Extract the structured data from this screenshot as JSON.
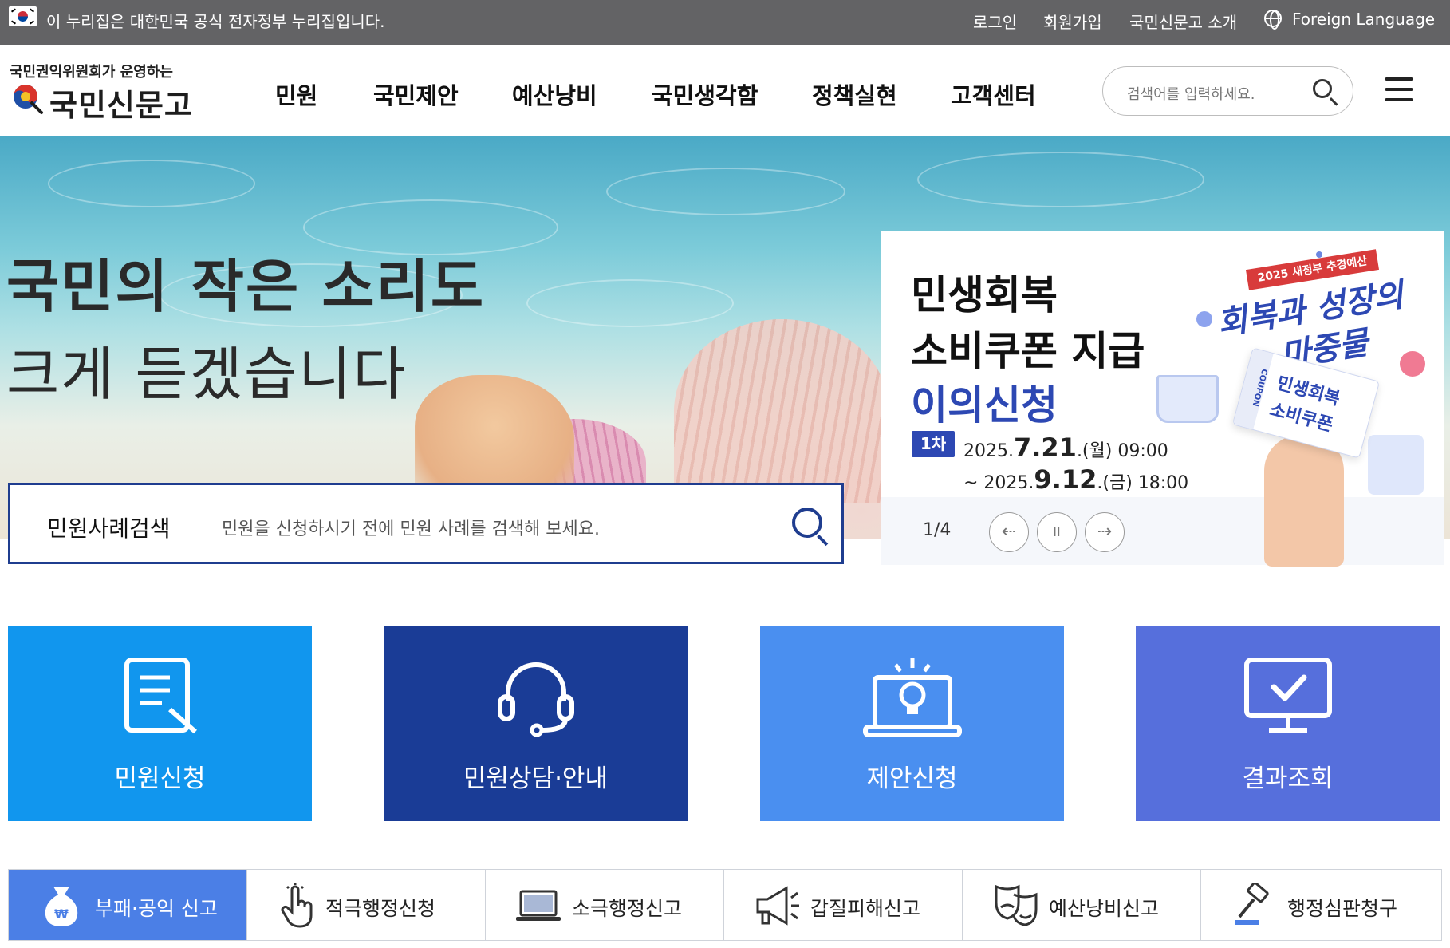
{
  "gov_bar": {
    "notice": "이 누리집은 대한민국 공식 전자정부 누리집입니다.",
    "links": [
      "로그인",
      "회원가입",
      "국민신문고 소개"
    ],
    "foreign_language": "Foreign Language"
  },
  "header": {
    "logo_subtitle": "국민권익위원회가 운영하는",
    "logo_title": "국민신문고",
    "nav": [
      "민원",
      "국민제안",
      "예산낭비",
      "국민생각함",
      "정책실현",
      "고객센터"
    ],
    "search_placeholder": "검색어를 입력하세요."
  },
  "hero": {
    "title_line1": "국민의 작은 소리도",
    "title_line2": "크게 듣겠습니다",
    "case_search": {
      "label": "민원사례검색",
      "placeholder": "민원을 신청하시기 전에 민원 사례를 검색해 보세요."
    }
  },
  "banner": {
    "title_line1": "민생회복",
    "title_line2": "소비쿠폰 지급",
    "title_line3": "이의신청",
    "round": "1차",
    "date_start_prefix": "2025.",
    "date_start_big": "7.21",
    "date_start_suffix": ".(월) 09:00",
    "date_end_prefix": "~ 2025.",
    "date_end_big": "9.12",
    "date_end_suffix": ".(금) 18:00",
    "promo_tag": "2025 새정부 추경예산",
    "promo_line1": "회복과 성장의",
    "promo_line2": "마중물",
    "coupon_line1": "민생회복",
    "coupon_line2": "소비쿠폰",
    "coupon_strip": "COUPON",
    "counter": "1/4",
    "controls": {
      "prev": "⇠",
      "pause": "II",
      "next": "⇢"
    }
  },
  "tiles": [
    {
      "label": "민원신청",
      "color": "#1196ee",
      "icon": "document-pen-icon"
    },
    {
      "label": "민원상담·안내",
      "color": "#1a3c96",
      "icon": "headset-icon"
    },
    {
      "label": "제안신청",
      "color": "#4a8ff0",
      "icon": "laptop-bulb-icon"
    },
    {
      "label": "결과조회",
      "color": "#566fdc",
      "icon": "monitor-check-icon"
    }
  ],
  "report_tabs": [
    {
      "label": "부패·공익 신고",
      "icon": "money-bag-icon",
      "active": true
    },
    {
      "label": "적극행정신청",
      "icon": "pointer-hand-icon",
      "active": false
    },
    {
      "label": "소극행정신고",
      "icon": "laptop-icon",
      "active": false
    },
    {
      "label": "갑질피해신고",
      "icon": "megaphone-icon",
      "active": false
    },
    {
      "label": "예산낭비신고",
      "icon": "masks-icon",
      "active": false
    },
    {
      "label": "행정심판청구",
      "icon": "gavel-icon",
      "active": false
    }
  ]
}
